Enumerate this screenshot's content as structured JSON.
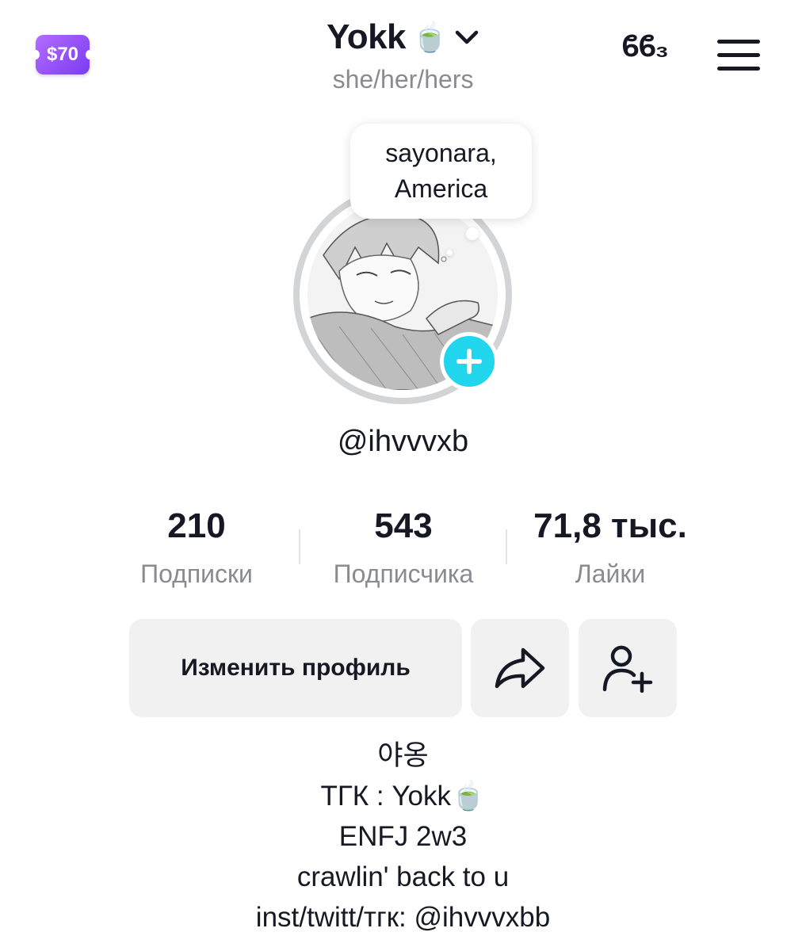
{
  "header": {
    "coupon_label": "$70",
    "username": "Yokk",
    "username_emoji": "🍵",
    "pronouns": "she/her/hers",
    "top_right_text": "ϐϐ₃"
  },
  "avatar": {
    "thought_text": "sayonara, America",
    "thought_line1": "sayonara,",
    "thought_line2": "America",
    "add_symbol": "+"
  },
  "handle": "@ihvvvxb",
  "stats": {
    "following": {
      "value": "210",
      "label": "Подписки"
    },
    "followers": {
      "value": "543",
      "label": "Подписчика"
    },
    "likes": {
      "value": "71,8 тыс.",
      "label": "Лайки"
    }
  },
  "actions": {
    "edit_profile_label": "Изменить профиль"
  },
  "bio": {
    "lines": [
      "야옹",
      "ТГК : Yokk🍵",
      "ENFJ 2w3",
      "crawlin' back to u",
      "inst/twitt/тгк: @ihvvvxbb"
    ]
  },
  "colors": {
    "accent_cyan": "#20d5ec",
    "coupon_purple": "#8a4cf5",
    "muted_text": "#8a8b91",
    "button_bg": "#f1f1f2"
  },
  "icons": {
    "menu": "hamburger-menu-icon",
    "share": "share-arrow-icon",
    "add_friend": "add-person-icon",
    "dropdown": "chevron-down-icon"
  }
}
